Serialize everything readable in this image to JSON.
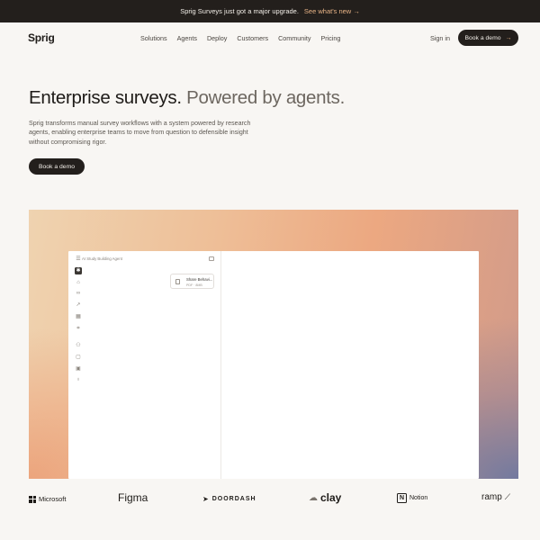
{
  "banner": {
    "text": "Sprig Surveys just got a major upgrade.",
    "link_label": "See what's new",
    "link_arrow": "→"
  },
  "nav": {
    "logo": "Sprig",
    "links": [
      "Solutions",
      "Agents",
      "Deploy",
      "Customers",
      "Community",
      "Pricing"
    ],
    "signin": "Sign in",
    "cta_label": "Book a demo",
    "cta_arrow": "→"
  },
  "hero": {
    "title_strong": "Enterprise surveys.",
    "title_muted": "Powered by agents.",
    "description": "Sprig transforms manual survey workflows with a system powered by research agents, enabling enterprise teams to move from question to defensible insight without compromising rigor.",
    "cta_label": "Book a demo"
  },
  "app_preview": {
    "header_label": "AI Study Building Agent",
    "file_card": {
      "title": "Share Behavi...",
      "meta": "PDF · 8MB"
    }
  },
  "logos": [
    "Microsoft",
    "Figma",
    "DOORDASH",
    "clay",
    "Notion",
    "ramp"
  ],
  "colors": {
    "dark": "#231f1c",
    "background": "#f8f6f3",
    "accent": "#e7b386"
  }
}
